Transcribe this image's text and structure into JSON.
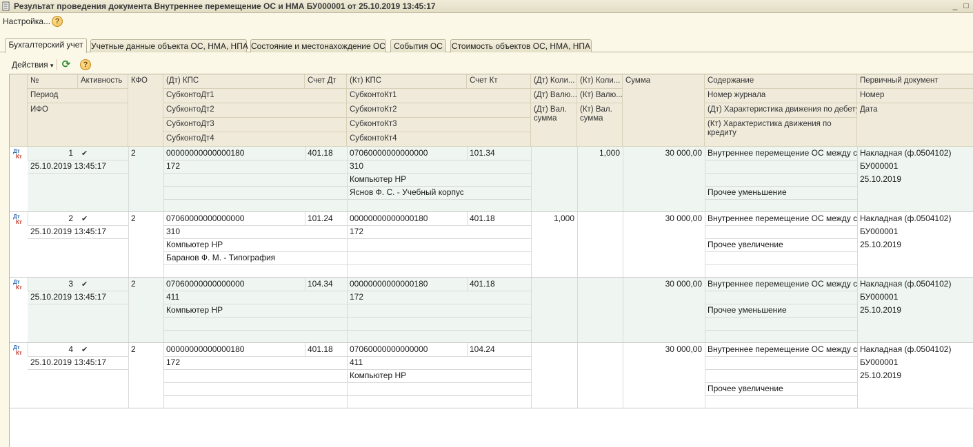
{
  "window": {
    "title": "Результат проведения документа Внутреннее перемещение ОС и НМА БУ000001 от 25.10.2019 13:45:17",
    "minimize_glyph": "_",
    "maximize_glyph": "□"
  },
  "menu": {
    "settings_label": "Настройка...",
    "help_glyph": "?"
  },
  "tabs": [
    {
      "label": "Бухгалтерский учет",
      "active": true
    },
    {
      "label": "Учетные данные объекта ОС, НМА, НПА",
      "active": false
    },
    {
      "label": "Состояние и местонахождение ОС",
      "active": false
    },
    {
      "label": "События ОС",
      "active": false
    },
    {
      "label": "Стоимость объектов ОС, НМА, НПА",
      "active": false
    }
  ],
  "toolbar": {
    "actions_label": "Действия",
    "dropdown_glyph": "▾",
    "refresh_glyph": "⟳",
    "help_glyph": "?"
  },
  "columns": {
    "num": "№",
    "activity": "Активность",
    "period": "Период",
    "ifo": "ИФО",
    "kfo": "КФО",
    "dt_kps": "(Дт) КПС",
    "dt_account": "Счет Дт",
    "dt_sub1": "СубконтоДт1",
    "dt_sub2": "СубконтоДт2",
    "dt_sub3": "СубконтоДт3",
    "dt_sub4": "СубконтоДт4",
    "kt_kps": "(Кт) КПС",
    "kt_account": "Счет Кт",
    "kt_sub1": "СубконтоКт1",
    "kt_sub2": "СубконтоКт2",
    "kt_sub3": "СубконтоКт3",
    "kt_sub4": "СубконтоКт4",
    "dt_qty": "(Дт) Коли...",
    "dt_cur": "(Дт) Валю...",
    "dt_cur_sum": "(Дт) Вал. сумма",
    "kt_qty": "(Кт) Коли...",
    "kt_cur": "(Кт) Валю...",
    "kt_cur_sum": "(Кт) Вал. сумма",
    "sum": "Сумма",
    "content": "Содержание",
    "journal": "Номер журнала",
    "dt_movement": "(Дт) Характеристика движения по дебету",
    "kt_movement": "(Кт) Характеристика движения по кредиту",
    "primary_doc": "Первичный документ",
    "doc_number": "Номер",
    "doc_date": "Дата"
  },
  "row_marker": {
    "dt": "Дт",
    "kt": "Кт",
    "check": "✔"
  },
  "rows": [
    {
      "num": "1",
      "period": "25.10.2019 13:45:17",
      "kfo": "2",
      "dt_kps": "00000000000000180",
      "dt_account": "401.18",
      "dt_sub": [
        "172",
        "",
        ""
      ],
      "kt_kps": "07060000000000000",
      "kt_account": "101.34",
      "kt_sub": [
        "310",
        "Компьютер HP",
        "Яснов Ф. С. - Учебный корпус"
      ],
      "dt_qty": "",
      "kt_qty": "1,000",
      "sum": "30 000,00",
      "content": "Внутреннее перемещение ОС между сч...",
      "dt_movement": "",
      "kt_movement": "Прочее уменьшение",
      "doc": "Накладная (ф.0504102)",
      "doc_number": "БУ000001",
      "doc_date": "25.10.2019"
    },
    {
      "num": "2",
      "period": "25.10.2019 13:45:17",
      "kfo": "2",
      "dt_kps": "07060000000000000",
      "dt_account": "101.24",
      "dt_sub": [
        "310",
        "Компьютер HP",
        "Баранов Ф. М. - Типография"
      ],
      "kt_kps": "00000000000000180",
      "kt_account": "401.18",
      "kt_sub": [
        "172",
        "",
        ""
      ],
      "dt_qty": "1,000",
      "kt_qty": "",
      "sum": "30 000,00",
      "content": "Внутреннее перемещение ОС между сч...",
      "dt_movement": "Прочее увеличение",
      "kt_movement": "",
      "doc": "Накладная (ф.0504102)",
      "doc_number": "БУ000001",
      "doc_date": "25.10.2019"
    },
    {
      "num": "3",
      "period": "25.10.2019 13:45:17",
      "kfo": "2",
      "dt_kps": "07060000000000000",
      "dt_account": "104.34",
      "dt_sub": [
        "411",
        "Компьютер HP",
        ""
      ],
      "kt_kps": "00000000000000180",
      "kt_account": "401.18",
      "kt_sub": [
        "172",
        "",
        ""
      ],
      "dt_qty": "",
      "kt_qty": "",
      "sum": "30 000,00",
      "content": "Внутреннее перемещение ОС между сч...",
      "dt_movement": "Прочее уменьшение",
      "kt_movement": "",
      "doc": "Накладная (ф.0504102)",
      "doc_number": "БУ000001",
      "doc_date": "25.10.2019"
    },
    {
      "num": "4",
      "period": "25.10.2019 13:45:17",
      "kfo": "2",
      "dt_kps": "00000000000000180",
      "dt_account": "401.18",
      "dt_sub": [
        "172",
        "",
        ""
      ],
      "kt_kps": "07060000000000000",
      "kt_account": "104.24",
      "kt_sub": [
        "411",
        "Компьютер HP",
        ""
      ],
      "dt_qty": "",
      "kt_qty": "",
      "sum": "30 000,00",
      "content": "Внутреннее перемещение ОС между сч...",
      "dt_movement": "",
      "kt_movement": "Прочее увеличение",
      "doc": "Накладная (ф.0504102)",
      "doc_number": "БУ000001",
      "doc_date": "25.10.2019"
    }
  ]
}
